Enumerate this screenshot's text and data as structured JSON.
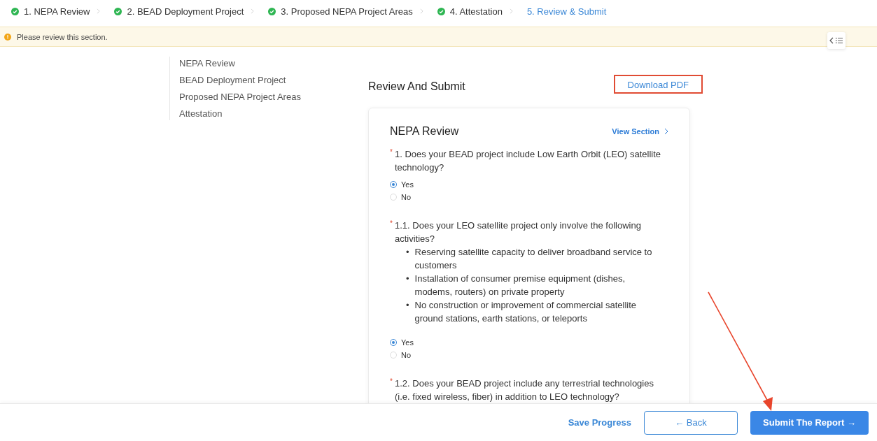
{
  "steps": [
    {
      "label": "1. NEPA Review",
      "done": true,
      "selected": false
    },
    {
      "label": "2. BEAD Deployment Project",
      "done": true,
      "selected": false
    },
    {
      "label": "3. Proposed NEPA Project Areas",
      "done": true,
      "selected": false
    },
    {
      "label": "4. Attestation",
      "done": true,
      "selected": false
    },
    {
      "label": "5. Review & Submit",
      "done": false,
      "selected": true
    }
  ],
  "banner": {
    "text": "Please review this section."
  },
  "section_nav": {
    "items": [
      {
        "label": "NEPA Review"
      },
      {
        "label": "BEAD Deployment Project"
      },
      {
        "label": "Proposed NEPA Project Areas"
      },
      {
        "label": "Attestation"
      }
    ]
  },
  "page_title": "Review And Submit",
  "download_button": {
    "label": "Download PDF",
    "highlighted": true
  },
  "card": {
    "title": "NEPA Review",
    "link": "View Section",
    "questions": [
      {
        "required": "*",
        "text": "1. Does your BEAD project include Low Earth Orbit (LEO) satellite technology?",
        "options": [
          {
            "label": "Yes",
            "selected": true
          },
          {
            "label": "No",
            "selected": false
          }
        ]
      },
      {
        "required": "*",
        "text": "1.1. Does your LEO satellite project only involve the following activities?",
        "bullet_mark": "•",
        "bullets": [
          "Reserving satellite capacity to deliver broadband service to customers",
          "Installation of consumer premise equipment (dishes, modems, routers) on private property",
          "No construction or improvement of commercial satellite ground stations, earth stations, or teleports"
        ],
        "options": [
          {
            "label": "Yes",
            "selected": true
          },
          {
            "label": "No",
            "selected": false
          }
        ]
      },
      {
        "required": "*",
        "text": "1.2. Does your BEAD project include any terrestrial technologies (i.e. fixed wireless, fiber) in addition to LEO technology?"
      }
    ]
  },
  "footer": {
    "save": "Save Progress",
    "back": "← Back",
    "submit": "Submit The Report →"
  },
  "annotations": [
    {
      "kind": "arrow"
    }
  ]
}
